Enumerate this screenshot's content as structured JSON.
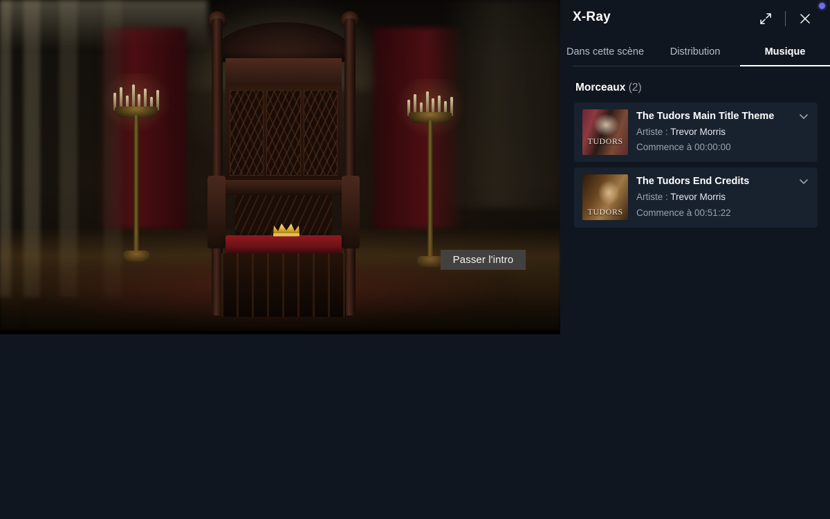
{
  "video": {
    "skip_intro_label": "Passer l'intro",
    "scene_description": "Throne room with ornate carved wooden throne, red velvet seat and gold crown"
  },
  "xray": {
    "title": "X-Ray",
    "expand_icon": "expand-diagonal-icon",
    "close_icon": "close-icon",
    "notification_dot_color": "#6f6cf2",
    "tabs": [
      {
        "label": "Dans cette scène",
        "active": false
      },
      {
        "label": "Distribution",
        "active": false
      },
      {
        "label": "Musique",
        "active": true
      }
    ],
    "section": {
      "title": "Morceaux",
      "count": "(2)"
    },
    "artist_label": "Artiste :",
    "tracks": [
      {
        "name": "The Tudors Main Title Theme",
        "artist": "Trevor Morris",
        "start": "Commence à 00:00:00",
        "art_caption": "TUDORS",
        "chevron": "chevron-down-icon"
      },
      {
        "name": "The Tudors End Credits",
        "artist": "Trevor Morris",
        "start": "Commence à 00:51:22",
        "art_caption": "TUDORS",
        "chevron": "chevron-down-icon"
      }
    ]
  }
}
